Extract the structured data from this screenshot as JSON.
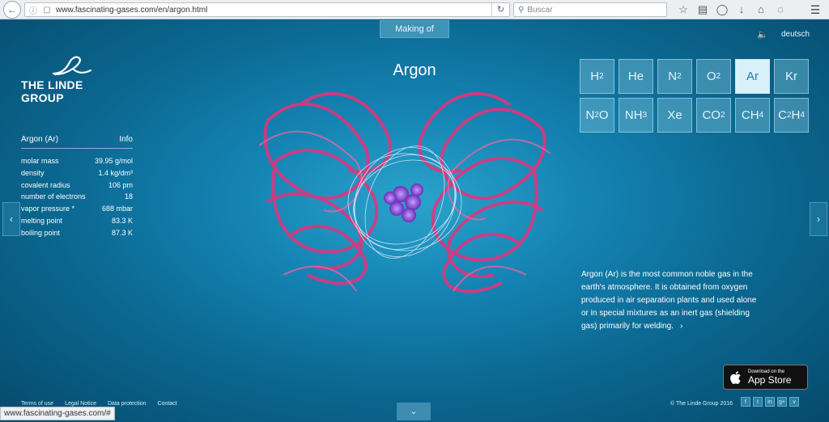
{
  "browser": {
    "url": "www.fascinating-gases.com/en/argon.html",
    "search_placeholder": "Buscar",
    "status_url": "www.fascinating-gases.com/#"
  },
  "page": {
    "making_of": "Making of",
    "language": "deutsch",
    "logo_text": "THE LINDE GROUP",
    "title": "Argon",
    "gases": [
      {
        "symbol": "H",
        "sub": "2",
        "active": false
      },
      {
        "symbol": "He",
        "sub": "",
        "active": false
      },
      {
        "symbol": "N",
        "sub": "2",
        "active": false
      },
      {
        "symbol": "O",
        "sub": "2",
        "active": false
      },
      {
        "symbol": "Ar",
        "sub": "",
        "active": true
      },
      {
        "symbol": "Kr",
        "sub": "",
        "active": false
      },
      {
        "symbol": "N",
        "sub": "2",
        "tail": "O",
        "active": false
      },
      {
        "symbol": "NH",
        "sub": "3",
        "active": false
      },
      {
        "symbol": "Xe",
        "sub": "",
        "active": false
      },
      {
        "symbol": "CO",
        "sub": "2",
        "active": false
      },
      {
        "symbol": "CH",
        "sub": "4",
        "active": false
      },
      {
        "symbol": "C",
        "sub": "2",
        "tail": "H",
        "sub2": "4",
        "active": false
      }
    ],
    "properties": {
      "header_label": "Argon (Ar)",
      "header_link": "Info",
      "rows": [
        {
          "label": "molar mass",
          "value": "39.95 g/mol"
        },
        {
          "label": "density",
          "value": "1.4 kg/dm³"
        },
        {
          "label": "covalent radius",
          "value": "106 pm"
        },
        {
          "label": "number of electrons",
          "value": "18"
        },
        {
          "label": "vapor pressure *",
          "value": "688 mbar"
        },
        {
          "label": "melting point",
          "value": "83.3 K"
        },
        {
          "label": "boiling point",
          "value": "87.3 K"
        }
      ]
    },
    "description": "Argon (Ar) is the most common noble gas in the earth's atmosphere. It is obtained from oxygen produced in air separation plants and used alone or in special mixtures as an inert gas (shielding gas) primarily for welding.",
    "appstore": {
      "small": "Download on the",
      "big": "App Store"
    },
    "footer_links": [
      "Terms of use",
      "Legal Notice",
      "Data protection",
      "Contact"
    ],
    "copyright": "© The Linde Group 2016",
    "social": [
      "f",
      "t",
      "in",
      "g+",
      "v"
    ]
  },
  "colors": {
    "accent_molecule": "#e8317a",
    "core": "#8a4fd6",
    "background": "#1483b3"
  }
}
